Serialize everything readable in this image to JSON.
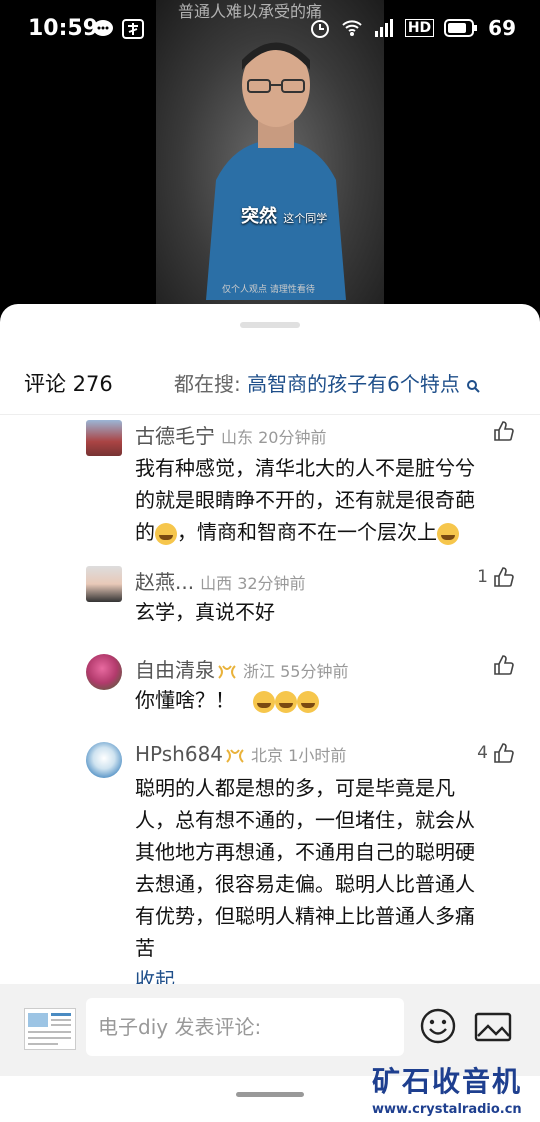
{
  "status_bar": {
    "time": "10:59",
    "net": "4G",
    "hd": "HD",
    "battery": "69"
  },
  "video": {
    "overlay_title": "普通人难以承受的痛",
    "subtitle_big": "突然",
    "subtitle_small": "这个同学",
    "note": "仅个人观点 请理性看待"
  },
  "header": {
    "count_label": "评论 276",
    "search_prefix": "都在搜:",
    "search_query": "高智商的孩子有6个特点"
  },
  "comments": [
    {
      "user": "古德毛宁",
      "location": "山东",
      "time": "20分钟前",
      "likes": "",
      "text_lines": [
        "我有种感觉，清华北大的人不是脏兮兮",
        "的就是眼睛睁不开的，还有就是很奇葩",
        "的",
        "，情商和智商不在一个层次上"
      ]
    },
    {
      "user": "赵燕...",
      "location": "山西",
      "time": "32分钟前",
      "likes": "1",
      "text": "玄学，真说不好"
    },
    {
      "user": "自由清泉",
      "location": "浙江",
      "time": "55分钟前",
      "likes": "",
      "text": "你懂啥？！"
    },
    {
      "user": "HPsh684",
      "location": "北京",
      "time": "1小时前",
      "likes": "4",
      "text_lines": [
        "聪明的人都是想的多，可是毕竟是凡",
        "人，总有想不通的，一但堵住，就会从",
        "其他地方再想通，不通用自己的聪明硬",
        "去想通，很容易走偏。聪明人比普通人",
        "有优势，但聪明人精神上比普通人多痛",
        "苦"
      ],
      "collapse": "收起"
    }
  ],
  "composer": {
    "placeholder": "电子diy 发表评论:"
  },
  "watermark": {
    "name": "矿石收音机",
    "url": "www.crystalradio.cn"
  }
}
